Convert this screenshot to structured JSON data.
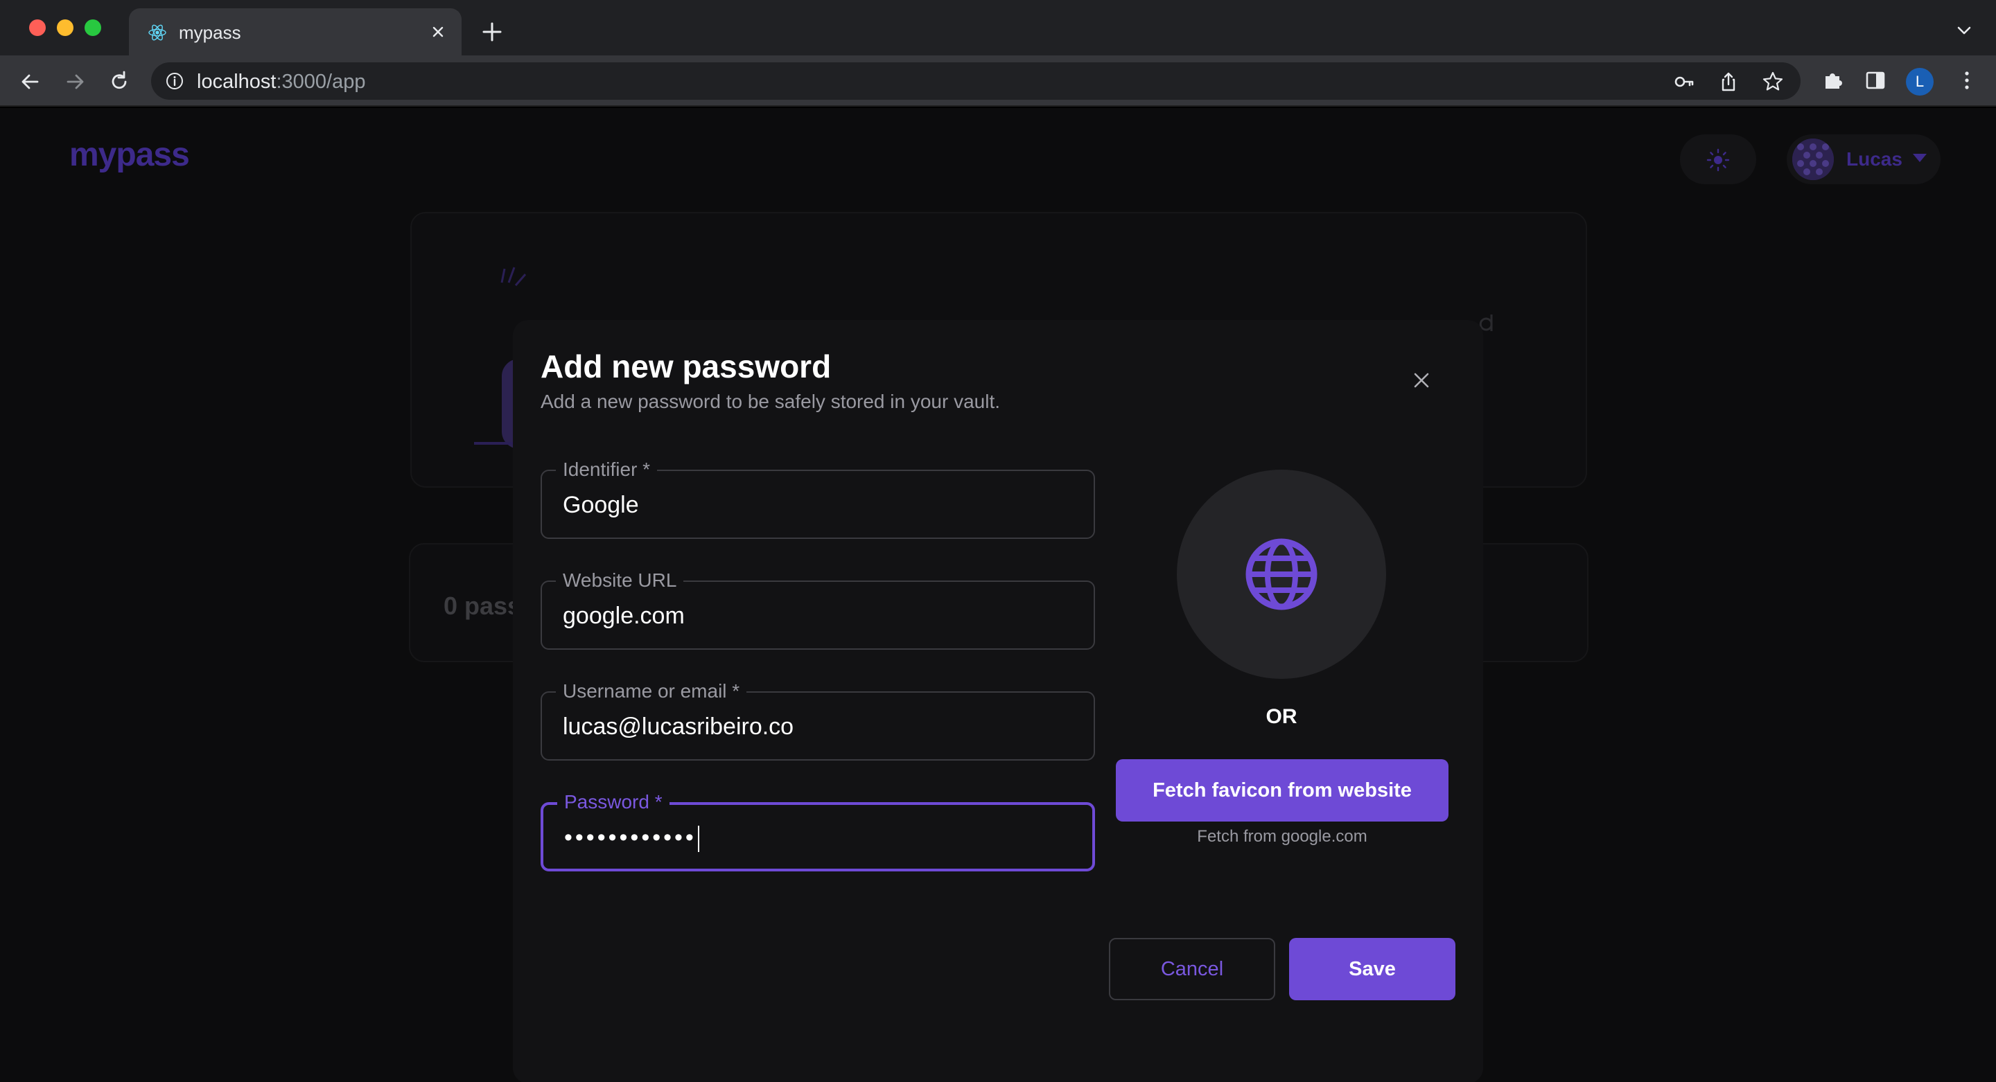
{
  "browser": {
    "tab_title": "mypass",
    "url_host": "localhost",
    "url_path": ":3000/app",
    "profile_initial": "L"
  },
  "app": {
    "brand": "mypass",
    "user_name": "Lucas",
    "bg_count_text": "0 pass"
  },
  "modal": {
    "title": "Add new password",
    "subtitle": "Add a new password to be safely stored in your vault.",
    "fields": {
      "identifier_label": "Identifier *",
      "identifier_value": "Google",
      "url_label": "Website URL",
      "url_value": "google.com",
      "username_label": "Username or email *",
      "username_value": "lucas@lucasribeiro.co",
      "password_label": "Password *",
      "password_value": "••••••••••••"
    },
    "or_text": "OR",
    "fetch_button": "Fetch favicon from website",
    "fetch_hint": "Fetch from google.com",
    "cancel_button": "Cancel",
    "save_button": "Save"
  },
  "colors": {
    "accent": "#6e4ad6",
    "modal_bg": "#121214",
    "page_bg": "#0c0c0d"
  }
}
